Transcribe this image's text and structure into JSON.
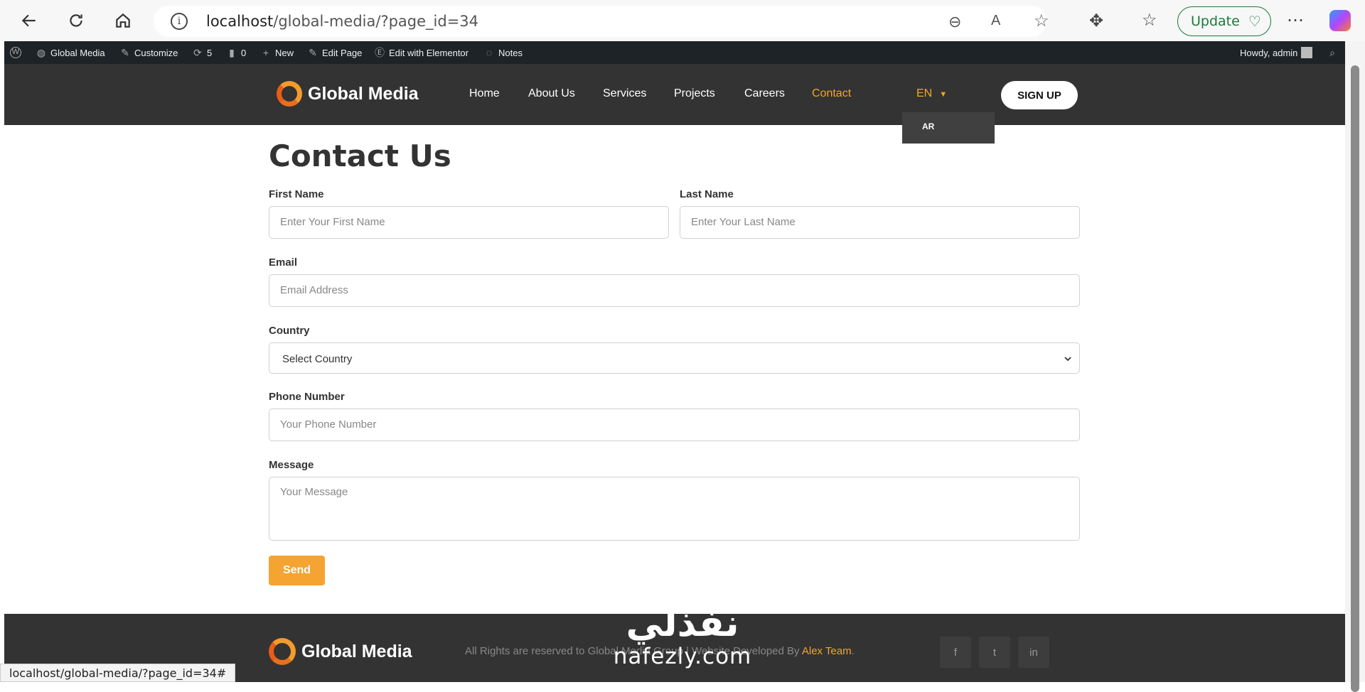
{
  "browser": {
    "url_host": "localhost",
    "url_path": "/global-media/?page_id=34",
    "update_label": "Update"
  },
  "wp_admin_bar": {
    "site_name": "Global Media",
    "customize": "Customize",
    "updates_count": "5",
    "comments_count": "0",
    "new": "New",
    "edit_page": "Edit Page",
    "edit_elementor": "Edit with Elementor",
    "notes": "Notes",
    "howdy": "Howdy, admin"
  },
  "header": {
    "logo_text": "Global Media",
    "nav": [
      "Home",
      "About Us",
      "Services",
      "Projects",
      "Careers",
      "Contact"
    ],
    "active_nav": "Contact",
    "lang_current": "EN",
    "lang_option": "AR",
    "signup": "SIGN UP"
  },
  "form": {
    "title": "Contact Us",
    "first_name_label": "First Name",
    "first_name_placeholder": "Enter Your First Name",
    "last_name_label": "Last Name",
    "last_name_placeholder": "Enter Your Last Name",
    "email_label": "Email",
    "email_placeholder": "Email Address",
    "country_label": "Country",
    "country_value": "Select Country",
    "phone_label": "Phone Number",
    "phone_placeholder": "Your Phone Number",
    "message_label": "Message",
    "message_placeholder": "Your Message",
    "send": "Send"
  },
  "footer": {
    "logo_text": "Global Media",
    "rights_prefix": "All Rights are reserved to Global Media Group | Website Developed By ",
    "developer": "Alex Team",
    "rights_suffix": ".",
    "social": [
      "facebook-icon",
      "twitter-icon",
      "linkedin-icon"
    ]
  },
  "status_bar": {
    "url": "localhost/global-media/?page_id=34#"
  },
  "watermark": {
    "arabic": "نفذلي",
    "latin": "nafezly.com"
  },
  "colors": {
    "accent": "#f5a623",
    "header_bg": "#333333",
    "wp_bar_bg": "#1d2327"
  }
}
